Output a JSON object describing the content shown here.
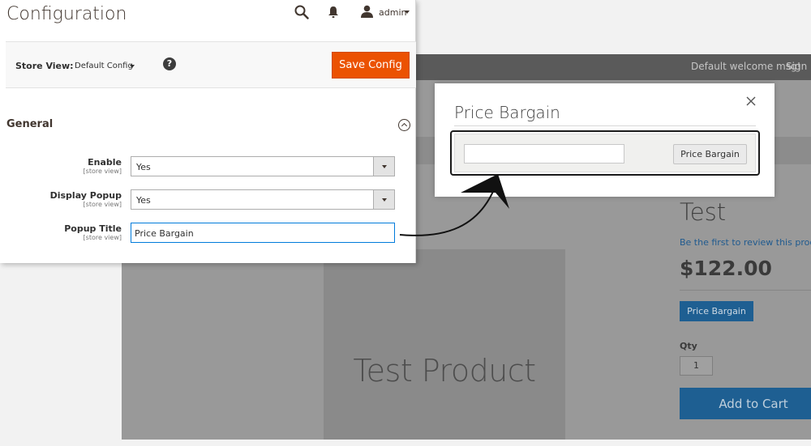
{
  "admin": {
    "page_title": "Configuration",
    "user_name": "admin",
    "scope": {
      "label": "Store View:",
      "value": "Default Config"
    },
    "help_symbol": "?",
    "save_label": "Save Config",
    "section_title": "General",
    "fields": [
      {
        "label": "Enable",
        "scope": "[store view]",
        "value": "Yes"
      },
      {
        "label": "Display Popup",
        "scope": "[store view]",
        "value": "Yes"
      },
      {
        "label": "Popup Title",
        "scope": "[store view]",
        "value": "Price Bargain"
      }
    ]
  },
  "modal": {
    "title": "Price Bargain",
    "button_label": "Price Bargain",
    "input_value": ""
  },
  "store": {
    "welcome": "Default welcome msg!",
    "sign_in": "Sign",
    "image_text": "Test Product",
    "product_name": "Test",
    "review_link": "Be the first to review this product",
    "price": "$122.00",
    "bargain_label": "Price Bargain",
    "qty_label": "Qty",
    "qty_value": "1",
    "add_to_cart": "Add to Cart"
  },
  "colors": {
    "accent": "#eb5202",
    "store_primary": "#1e5f92",
    "overlay": "#999999",
    "focus_border": "#007bdb"
  },
  "icons": [
    "search-icon",
    "bell-icon",
    "user-icon",
    "help-icon",
    "close-icon",
    "collapse-chevron-icon",
    "curved-arrow"
  ]
}
